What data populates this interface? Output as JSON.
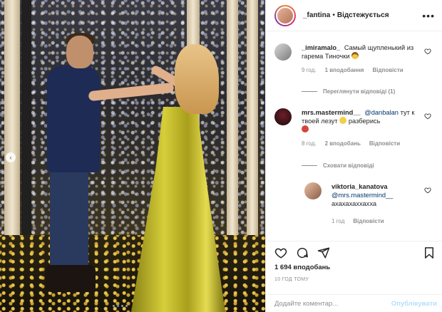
{
  "post": {
    "author": "_fantina",
    "separator": "•",
    "follow_label": "Відстежується",
    "more_label": "•••"
  },
  "comments": [
    {
      "username": "_imiramalo_",
      "text": "Самый щупленький из гарема Тиночки",
      "emoji": "cowboy-emoji",
      "time": "9 год.",
      "likes": "1 вподобання",
      "reply_label": "Відповісти"
    },
    {
      "username": "mrs.mastermind__",
      "mention": "@danbalan",
      "text": "тут к твоей лезут",
      "text2": "разберись",
      "time": "8 год.",
      "likes": "2 вподобань",
      "reply_label": "Відповісти"
    },
    {
      "username": "viktoria_kanatova",
      "mention": "@mrs.mastermind__",
      "text": "ахахахаххахха",
      "time": "1 год",
      "reply_label": "Відповісти"
    }
  ],
  "view_replies_label": "Переглянути відповіді (1)",
  "hide_replies_label": "Сховати відповіді",
  "likes_count": "1 694 вподобань",
  "posted_time": "10 ГОД ТОМУ",
  "comment_input": {
    "placeholder": "Додайте коментар...",
    "value": ""
  },
  "publish_label": "Опублікувати",
  "carousel": {
    "total": 4,
    "current": 2
  },
  "colors": {
    "link": "#00376b",
    "publish_disabled": "#b2dffc",
    "muted": "#8e8e8e"
  }
}
